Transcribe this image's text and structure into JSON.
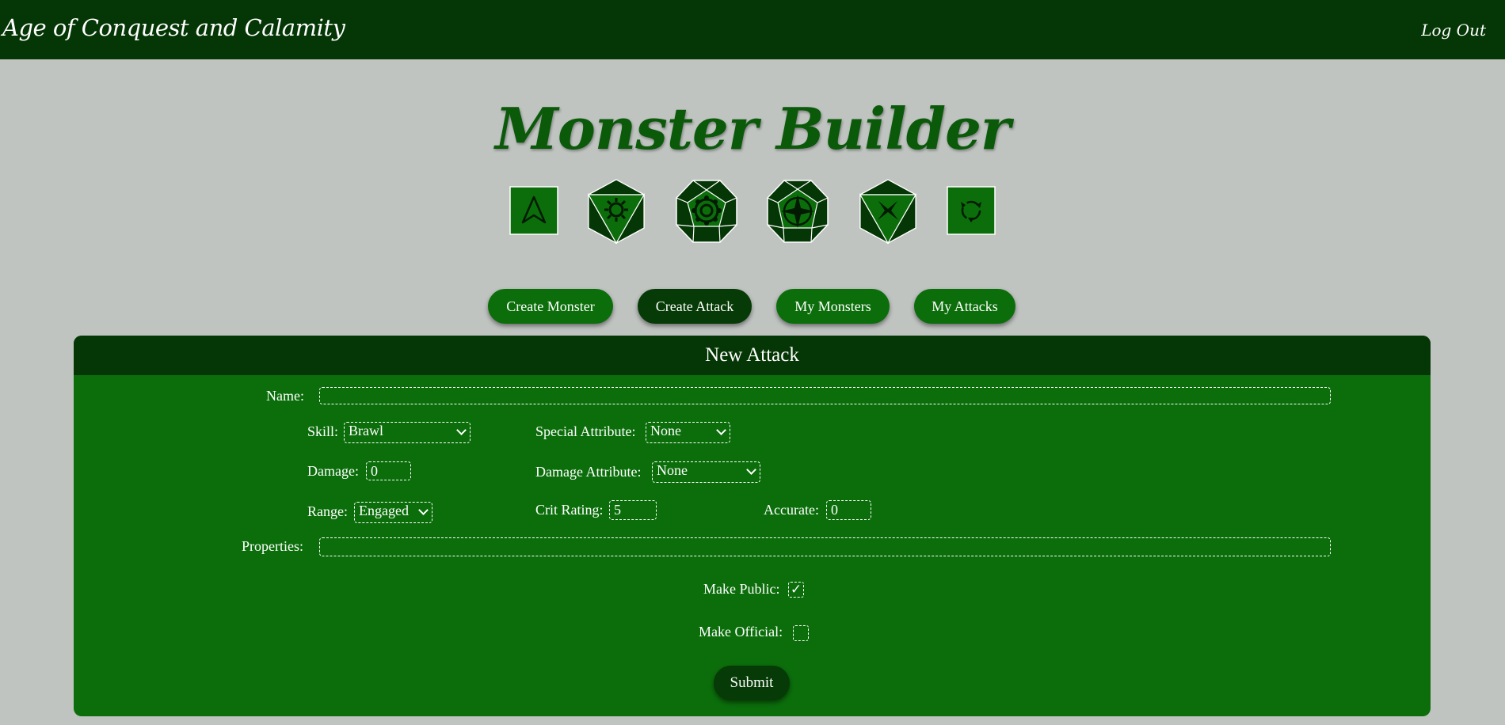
{
  "header": {
    "app_title": "Age of Conquest and Calamity",
    "logout": "Log Out"
  },
  "page_title": "Monster Builder",
  "dice": [
    {
      "name": "d4-arrow-die-icon"
    },
    {
      "name": "d6-sun-die-icon"
    },
    {
      "name": "d8-gear-die-icon"
    },
    {
      "name": "d10-compass-die-icon"
    },
    {
      "name": "d12-cross-die-icon"
    },
    {
      "name": "d20-spiral-die-icon"
    }
  ],
  "tabs": {
    "create_monster": "Create Monster",
    "create_attack": "Create Attack",
    "my_monsters": "My Monsters",
    "my_attacks": "My Attacks",
    "active": "create_attack"
  },
  "form": {
    "title": "New Attack",
    "name_label": "Name:",
    "name_value": "",
    "skill_label": "Skill:",
    "skill_value": "Brawl",
    "special_attribute_label": "Special Attribute:",
    "special_attribute_value": "None",
    "damage_label": "Damage:",
    "damage_value": "0",
    "damage_attribute_label": "Damage Attribute:",
    "damage_attribute_value": "None",
    "range_label": "Range:",
    "range_value": "Engaged",
    "crit_rating_label": "Crit Rating:",
    "crit_rating_value": "5",
    "accurate_label": "Accurate:",
    "accurate_value": "0",
    "properties_label": "Properties:",
    "properties_value": "",
    "make_public_label": "Make Public:",
    "make_public_checked": true,
    "check_mark": "✓",
    "make_official_label": "Make Official:",
    "make_official_checked": false,
    "submit_label": "Submit"
  },
  "colors": {
    "header_bg": "#053605",
    "panel_bg": "#0b6e0b",
    "page_bg": "#c0c4c1",
    "title_green": "#0a5a0a"
  }
}
